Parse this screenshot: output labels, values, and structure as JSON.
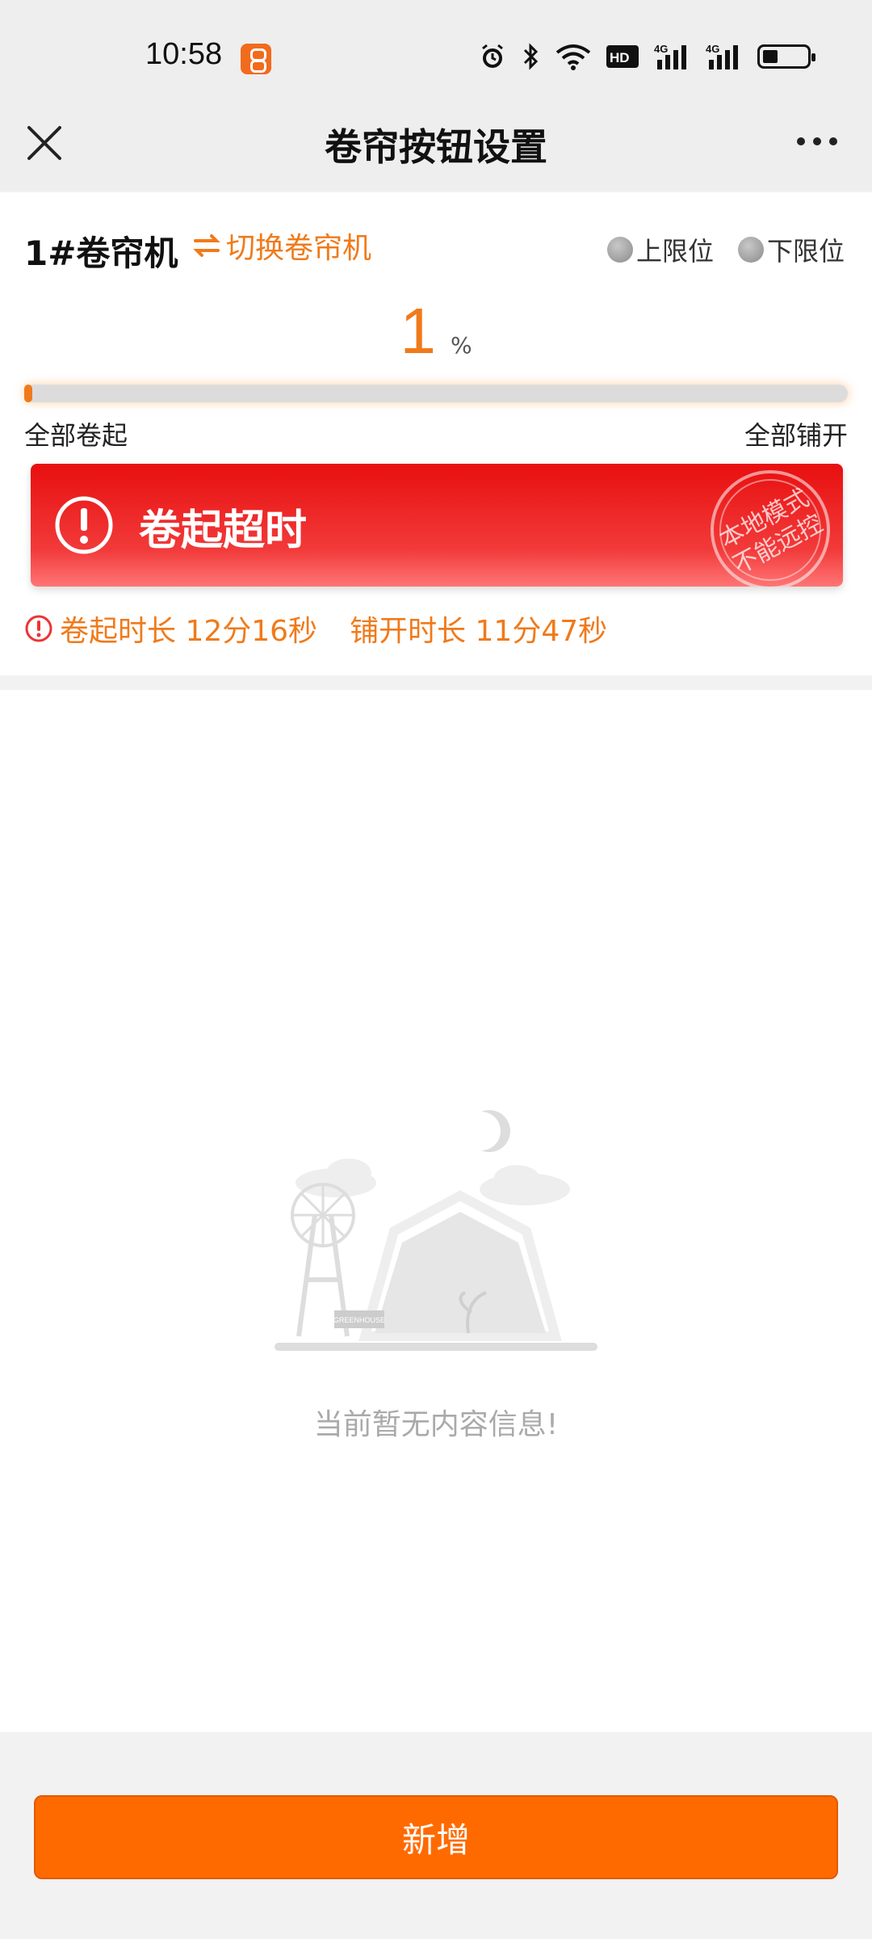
{
  "status_bar": {
    "time": "10:58",
    "icons": [
      "app-badge-icon",
      "alarm-icon",
      "bluetooth-icon",
      "wifi-icon",
      "hd-icon",
      "signal-4g-icon",
      "signal-4g-icon",
      "battery-icon"
    ],
    "hd_label": "HD",
    "net_label_1": "4G",
    "net_label_2": "4G"
  },
  "nav": {
    "title": "卷帘按钮设置"
  },
  "machine": {
    "name": "1#卷帘机",
    "switch_label": "切换卷帘机",
    "limit_up": "上限位",
    "limit_down": "下限位"
  },
  "progress": {
    "value": "1",
    "unit": "%",
    "fraction": 0.01,
    "left_label": "全部卷起",
    "right_label": "全部铺开"
  },
  "alert": {
    "text": "卷起超时",
    "stamp_line1": "本地模式",
    "stamp_line2": "不能远控"
  },
  "durations": {
    "roll_label": "卷起时长 12分16秒",
    "unroll_label": "铺开时长 11分47秒"
  },
  "empty": {
    "message": "当前暂无内容信息!",
    "illustration_sign": "GREENHOUSE"
  },
  "footer": {
    "add_label": "新增"
  },
  "colors": {
    "accent": "#f07a1a",
    "button": "#ff6a00",
    "alert_red": "#e80f0f"
  }
}
